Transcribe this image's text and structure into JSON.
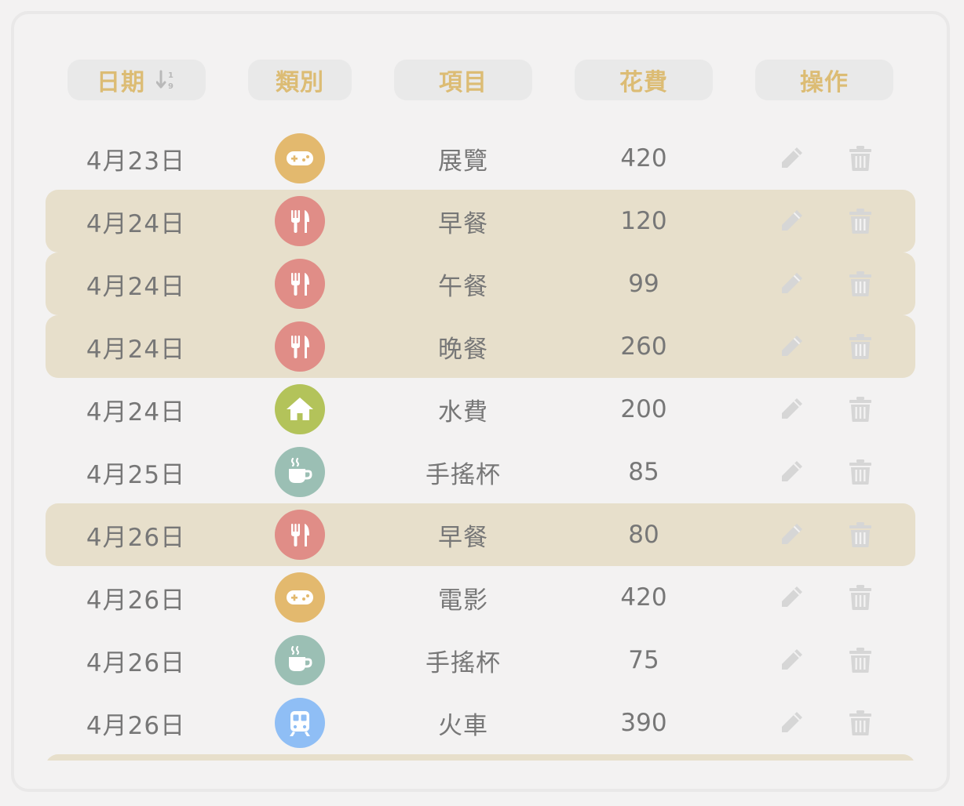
{
  "headers": {
    "date": "日期",
    "category": "類別",
    "item": "項目",
    "cost": "花費",
    "actions": "操作"
  },
  "colors": {
    "header_text": "#dcbc74",
    "highlight_row": "#e7dfcb",
    "entertainment": "#e3b96e",
    "food": "#e08d87",
    "home": "#b3c35a",
    "drink": "#9bbfb4",
    "transport": "#8fbef5"
  },
  "rows": [
    {
      "date": "4月23日",
      "category_icon": "gamepad-icon",
      "item": "展覽",
      "cost": "420",
      "highlighted": false
    },
    {
      "date": "4月24日",
      "category_icon": "utensils-icon",
      "item": "早餐",
      "cost": "120",
      "highlighted": true
    },
    {
      "date": "4月24日",
      "category_icon": "utensils-icon",
      "item": "午餐",
      "cost": "99",
      "highlighted": true
    },
    {
      "date": "4月24日",
      "category_icon": "utensils-icon",
      "item": "晚餐",
      "cost": "260",
      "highlighted": true
    },
    {
      "date": "4月24日",
      "category_icon": "home-icon",
      "item": "水費",
      "cost": "200",
      "highlighted": false
    },
    {
      "date": "4月25日",
      "category_icon": "coffee-cup-icon",
      "item": "手搖杯",
      "cost": "85",
      "highlighted": false
    },
    {
      "date": "4月26日",
      "category_icon": "utensils-icon",
      "item": "早餐",
      "cost": "80",
      "highlighted": true
    },
    {
      "date": "4月26日",
      "category_icon": "gamepad-icon",
      "item": "電影",
      "cost": "420",
      "highlighted": false
    },
    {
      "date": "4月26日",
      "category_icon": "coffee-cup-icon",
      "item": "手搖杯",
      "cost": "75",
      "highlighted": false
    },
    {
      "date": "4月26日",
      "category_icon": "train-icon",
      "item": "火車",
      "cost": "390",
      "highlighted": false
    },
    {
      "date": "",
      "category_icon": "",
      "item": "",
      "cost": "",
      "highlighted": true
    }
  ]
}
